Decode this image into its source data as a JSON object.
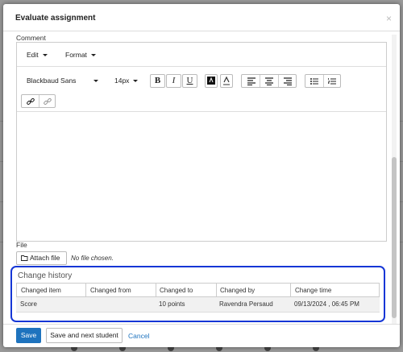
{
  "modal": {
    "title": "Evaluate assignment",
    "close_glyph": "×"
  },
  "comment": {
    "label": "Comment"
  },
  "editor": {
    "menu": [
      {
        "label": "Edit"
      },
      {
        "label": "Format"
      }
    ],
    "font_family": "Blackbaud Sans",
    "font_size": "14px",
    "bold": "B",
    "italic": "I",
    "underline": "U",
    "icons": [
      "text-color-icon",
      "highlight-icon",
      "align-left-icon",
      "align-center-icon",
      "align-right-icon",
      "bullet-list-icon",
      "numbered-list-icon",
      "link-icon",
      "unlink-icon"
    ]
  },
  "file": {
    "label": "File",
    "attach_label": "Attach file",
    "status": "No file chosen."
  },
  "history": {
    "title": "Change history",
    "columns": [
      "Changed item",
      "Changed from",
      "Changed to",
      "Changed by",
      "Change time"
    ],
    "rows": [
      {
        "item": "Score",
        "from": "",
        "to": "10 points",
        "by": "Ravendra Persaud",
        "time": "09/13/2024 , 06:45 PM"
      }
    ]
  },
  "footer": {
    "save": "Save",
    "save_next": "Save and next student",
    "cancel": "Cancel"
  },
  "colors": {
    "accent": "#1e73be",
    "highlight_border": "#1536d6"
  }
}
